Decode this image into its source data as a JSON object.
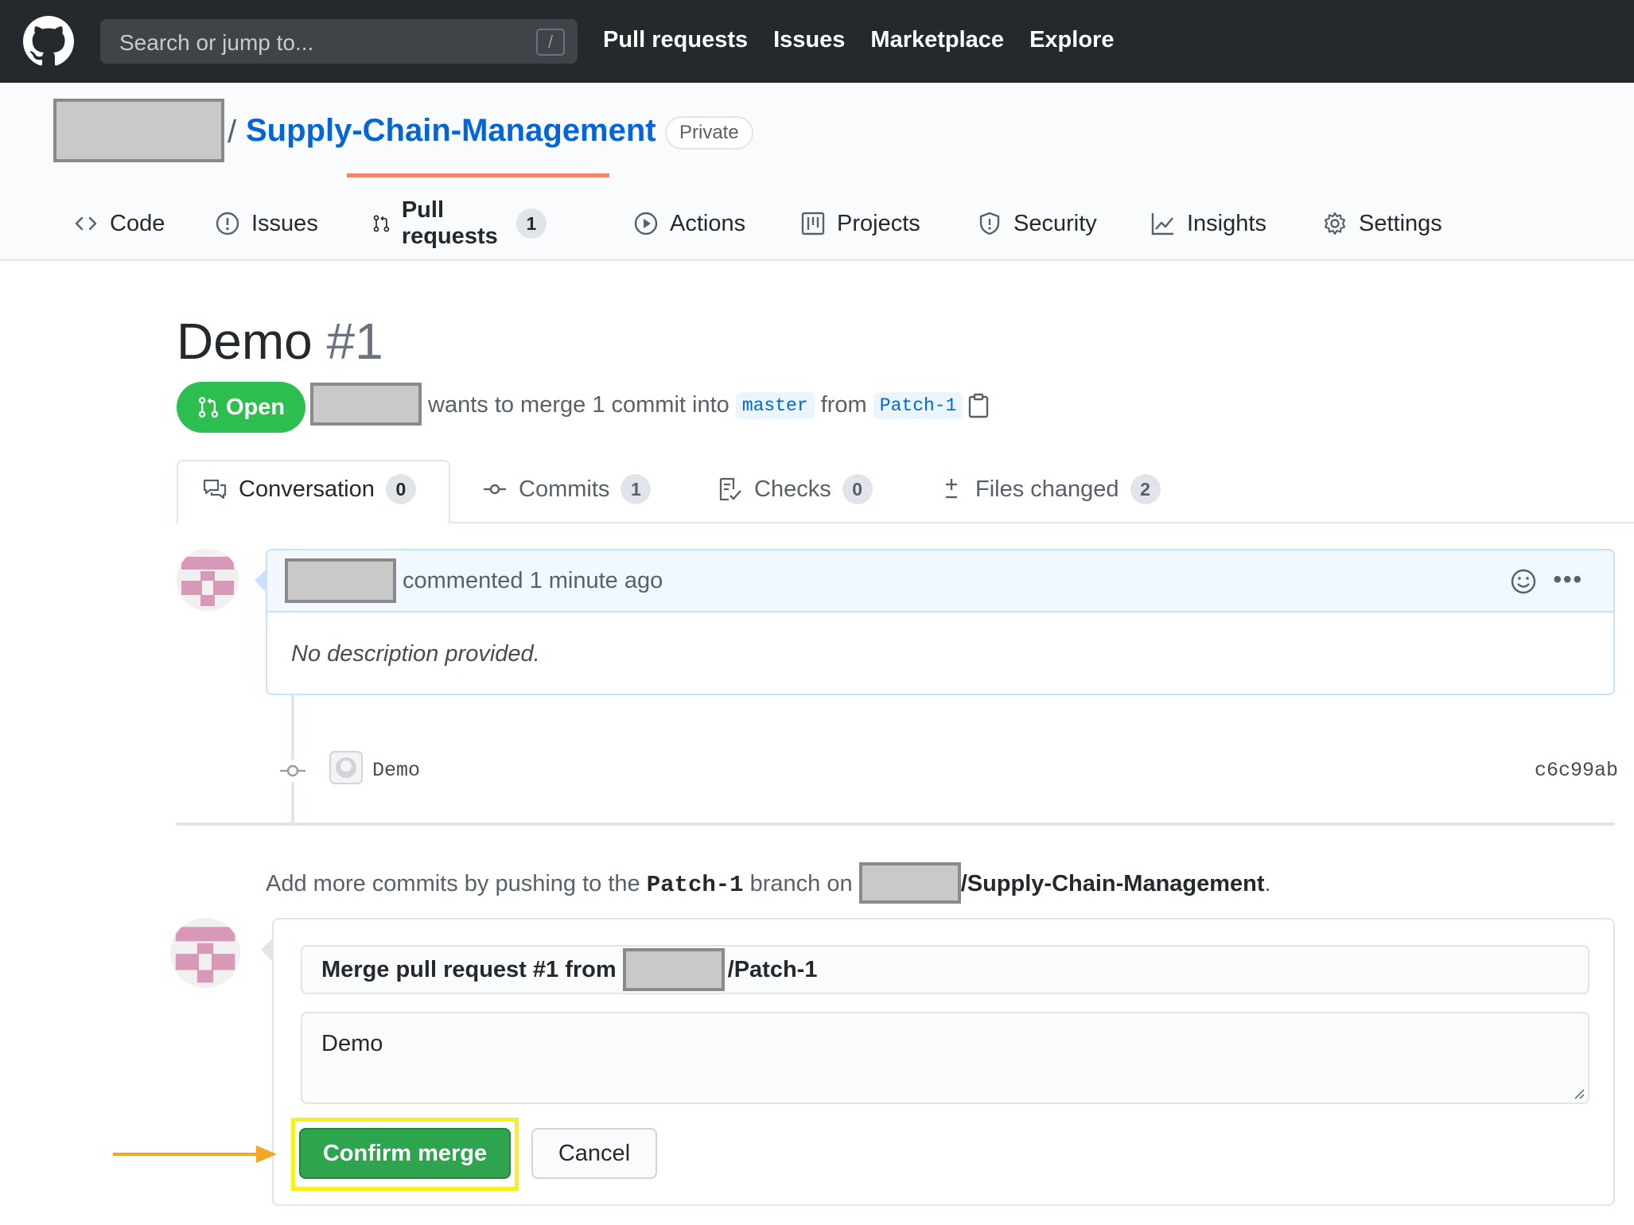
{
  "header": {
    "search_placeholder": "Search or jump to...",
    "search_shortcut": "/",
    "nav": [
      "Pull requests",
      "Issues",
      "Marketplace",
      "Explore"
    ]
  },
  "repo": {
    "separator": "/",
    "name": "Supply-Chain-Management",
    "visibility": "Private",
    "tabs": [
      {
        "label": "Code",
        "icon": "code-icon"
      },
      {
        "label": "Issues",
        "icon": "issue-icon"
      },
      {
        "label": "Pull requests",
        "icon": "pull-request-icon",
        "count": "1",
        "active": true
      },
      {
        "label": "Actions",
        "icon": "play-icon"
      },
      {
        "label": "Projects",
        "icon": "project-icon"
      },
      {
        "label": "Security",
        "icon": "shield-icon"
      },
      {
        "label": "Insights",
        "icon": "graph-icon"
      },
      {
        "label": "Settings",
        "icon": "gear-icon"
      }
    ]
  },
  "pr": {
    "title": "Demo",
    "number": "#1",
    "state": "Open",
    "merge_text_a": "wants to merge 1 commit into",
    "base_branch": "master",
    "merge_text_b": "from",
    "head_branch": "Patch-1",
    "tabs": [
      {
        "label": "Conversation",
        "count": "0",
        "icon": "comment-discussion-icon"
      },
      {
        "label": "Commits",
        "count": "1",
        "icon": "commit-icon"
      },
      {
        "label": "Checks",
        "count": "0",
        "icon": "checklist-icon"
      },
      {
        "label": "Files changed",
        "count": "2",
        "icon": "diff-icon"
      }
    ]
  },
  "comment": {
    "meta": "commented 1 minute ago",
    "body": "No description provided."
  },
  "commit": {
    "message": "Demo",
    "sha": "c6c99ab"
  },
  "push_note": {
    "prefix": "Add more commits by pushing to the",
    "branch": "Patch-1",
    "middle": "branch on",
    "repo": "/Supply-Chain-Management",
    "suffix": "."
  },
  "merge_form": {
    "title_prefix": "Merge pull request #1 from",
    "title_suffix": "/Patch-1",
    "body": "Demo",
    "confirm_label": "Confirm merge",
    "cancel_label": "Cancel"
  },
  "colors": {
    "header_bg": "#24292e",
    "link": "#0366d6",
    "success": "#2ea44f",
    "tab_underline": "#f9826c",
    "highlight": "#f9f01f",
    "arrow": "#f5a623"
  }
}
